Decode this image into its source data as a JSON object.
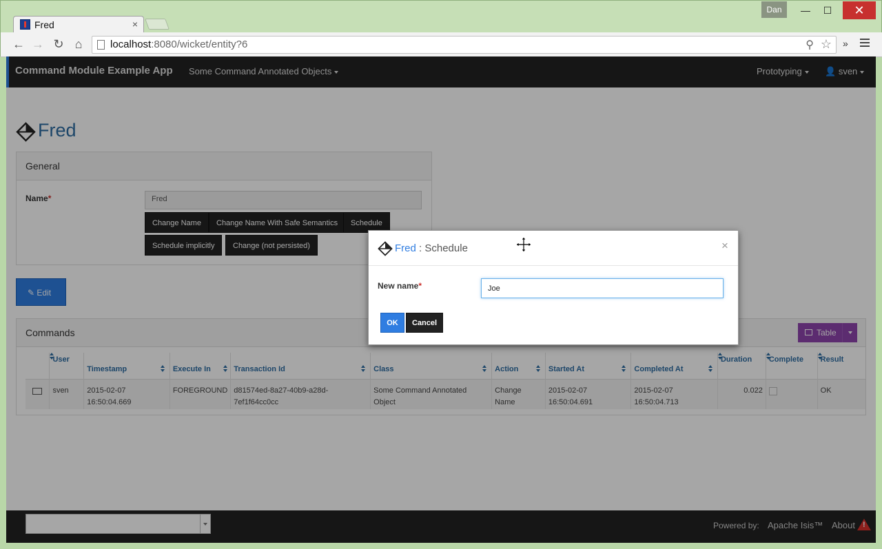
{
  "browser": {
    "tab_title": "Fred",
    "tab_close": "×",
    "user_chip": "Dan",
    "url_host": "localhost",
    "url_rest": ":8080/wicket/entity?6",
    "win_min": "—",
    "win_max": "☐",
    "win_close": "✕",
    "ext_label": "»"
  },
  "app": {
    "brand": "Command Module Example App",
    "menu_objects": "Some Command Annotated Objects",
    "menu_prototyping": "Prototyping",
    "menu_user": "sven"
  },
  "entity": {
    "title": "Fred",
    "general_heading": "General",
    "name_label": "Name",
    "required_mark": "*",
    "name_value": "Fred",
    "actions": [
      "Change Name",
      "Change Name With Safe Semantics",
      "Schedule",
      "Schedule implicitly",
      "Change (not persisted)"
    ],
    "edit_label": "Edit"
  },
  "commands": {
    "heading": "Commands",
    "table_button": "Table",
    "columns": [
      "User",
      "Timestamp",
      "Execute In",
      "Transaction Id",
      "Class",
      "Action",
      "Started At",
      "Completed At",
      "Duration",
      "Complete",
      "Result"
    ],
    "rows": [
      {
        "user": "sven",
        "timestamp": "2015-02-07 16:50:04.669",
        "execute_in": "FOREGROUND",
        "transaction_id": "d81574ed-8a27-40b9-a28d-7ef1f64cc0cc",
        "class": "Some Command Annotated Object",
        "action": "Change Name",
        "started_at": "2015-02-07 16:50:04.691",
        "completed_at": "2015-02-07 16:50:04.713",
        "duration": "0.022",
        "complete": true,
        "result": "OK"
      }
    ]
  },
  "modal": {
    "entity": "Fred",
    "separator": " : ",
    "action": "Schedule",
    "close": "×",
    "field_label": "New name",
    "required_mark": "*",
    "field_value": "Joe",
    "ok_label": "OK",
    "cancel_label": "Cancel"
  },
  "footer": {
    "powered_by": "Powered by:",
    "apache_isis": "Apache Isis™",
    "about": "About"
  },
  "colors": {
    "primary": "#2f7de1",
    "navbar": "#222222",
    "link": "#2d6ca2",
    "table_button": "#8e44ad",
    "required": "#c9302c"
  }
}
